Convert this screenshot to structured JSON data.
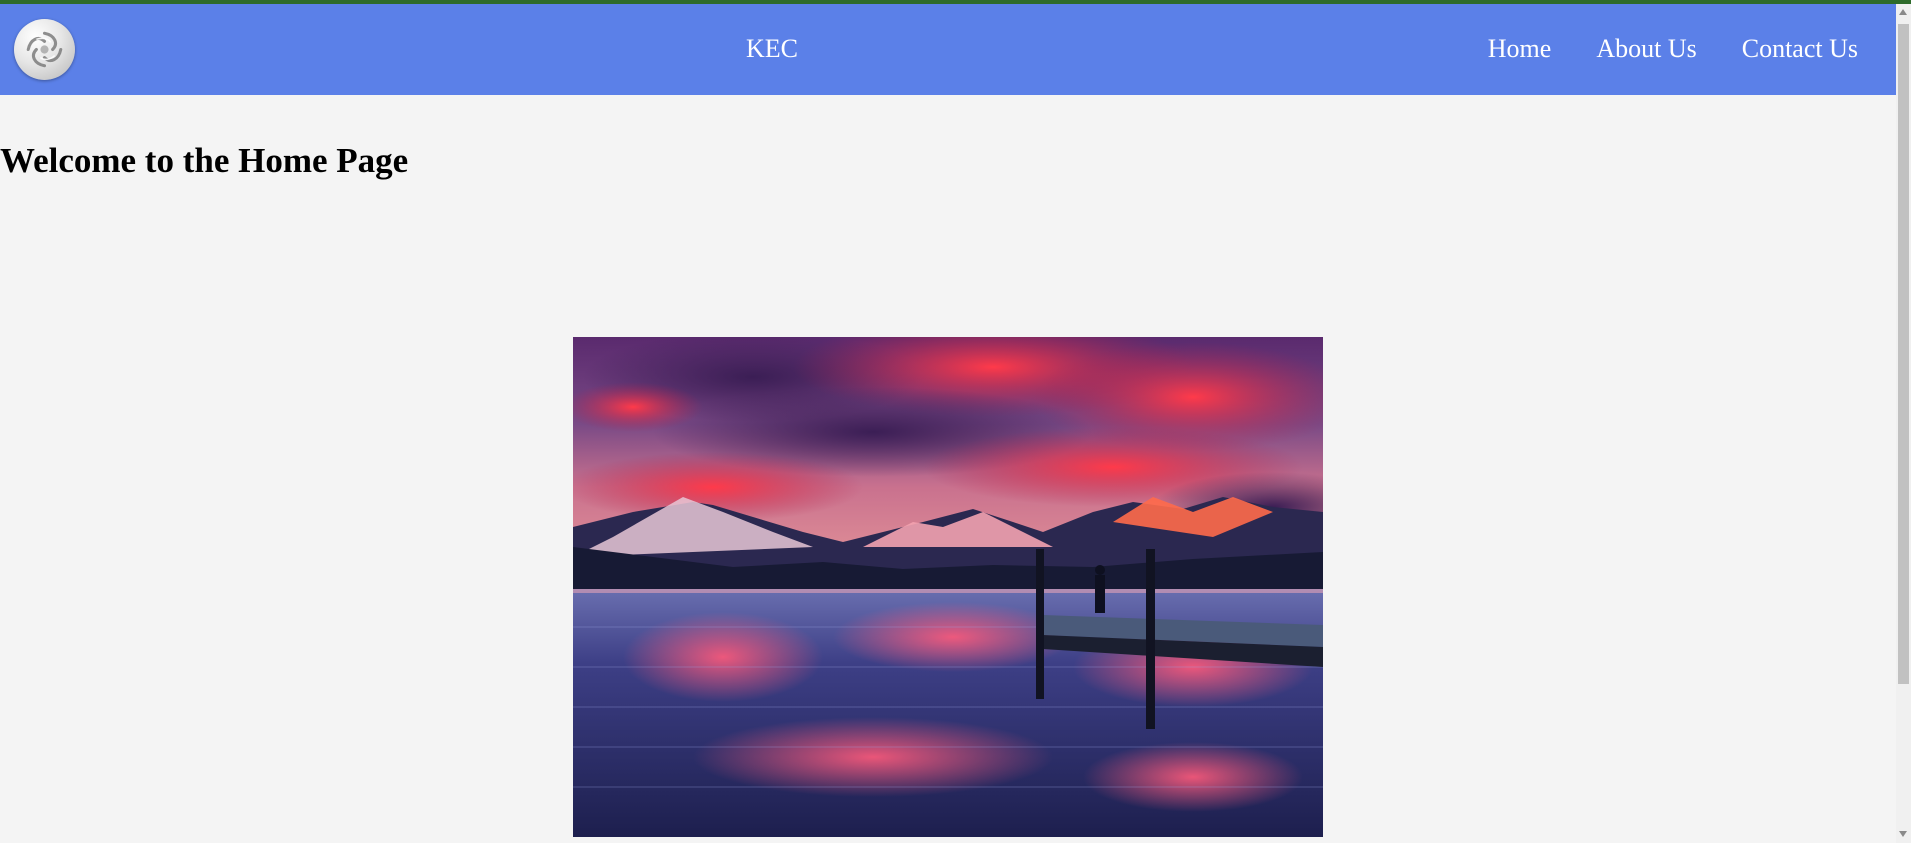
{
  "colors": {
    "navbar": "#5b80e8",
    "top_strip": "#2e6b2b",
    "page_background": "#f4f4f4",
    "nav_text": "#ffffff"
  },
  "header": {
    "logo_icon": "swirl-logo-icon",
    "brand": "KEC",
    "nav": [
      {
        "label": "Home"
      },
      {
        "label": "About Us"
      },
      {
        "label": "Contact Us"
      }
    ]
  },
  "main": {
    "heading": "Welcome to the Home Page",
    "hero_image": "sunset-lake-mountains-dock"
  }
}
